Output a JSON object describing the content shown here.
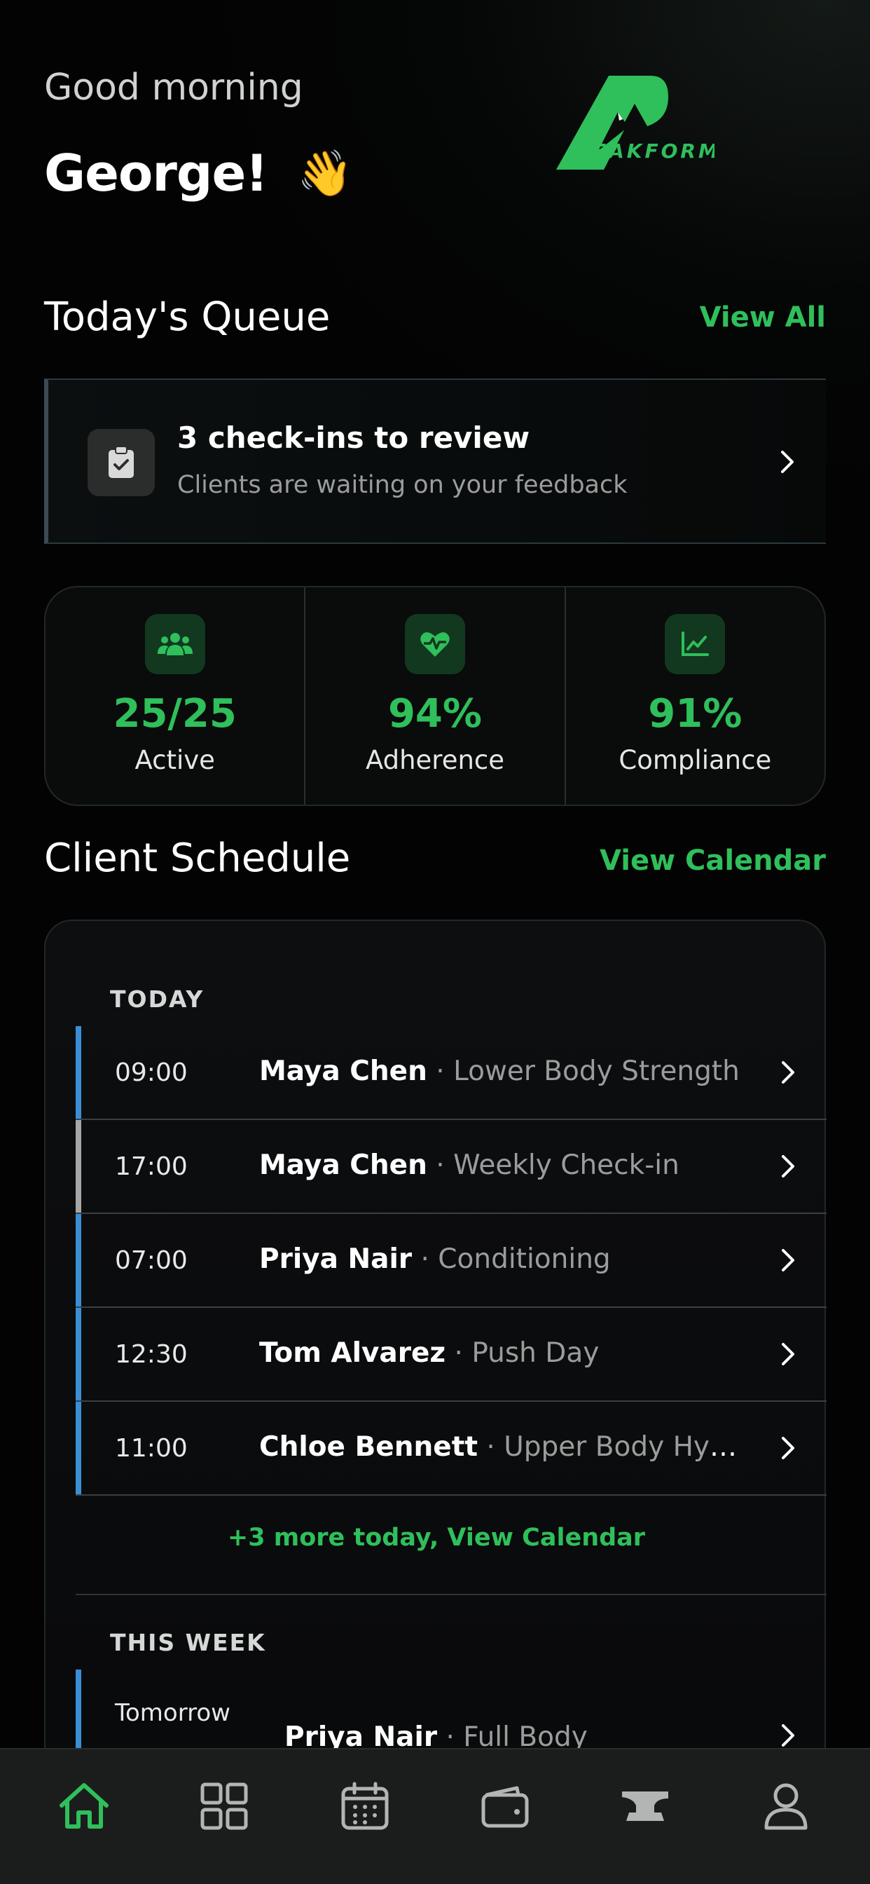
{
  "header": {
    "greeting": "Good morning",
    "name": "George!",
    "wave_emoji": "👋",
    "logo_text": "EAKFORM",
    "logo_letter": "P"
  },
  "queue": {
    "title": "Today's Queue",
    "view_all": "View All",
    "card_title": "3 check-ins to review",
    "card_subtitle": "Clients are waiting on your feedback",
    "icon": "clipboard-check-icon"
  },
  "stats": [
    {
      "value": "25/25",
      "label": "Active",
      "icon": "users-icon"
    },
    {
      "value": "94%",
      "label": "Adherence",
      "icon": "heart-pulse-icon"
    },
    {
      "value": "91%",
      "label": "Compliance",
      "icon": "chart-line-icon"
    }
  ],
  "schedule": {
    "title": "Client Schedule",
    "view_calendar": "View Calendar",
    "today_label": "TODAY",
    "week_label": "THIS WEEK",
    "today": [
      {
        "time": "09:00",
        "name": "Maya Chen",
        "sep": " · ",
        "desc": "Lower Body Strength",
        "bar": "#3b8ed4"
      },
      {
        "time": "17:00",
        "name": "Maya Chen",
        "sep": " · ",
        "desc": "Weekly Check-in",
        "bar": "#a6a6a6"
      },
      {
        "time": "07:00",
        "name": "Priya Nair",
        "sep": " · ",
        "desc": "Conditioning",
        "bar": "#3b8ed4"
      },
      {
        "time": "12:30",
        "name": "Tom Alvarez",
        "sep": " · ",
        "desc": "Push Day",
        "bar": "#3b8ed4"
      },
      {
        "time": "11:00",
        "name": "Chloe Bennett",
        "sep": " · ",
        "desc": "Upper Body Hypertrophy",
        "bar": "#3b8ed4"
      }
    ],
    "more_link": "+3 more today, View Calendar",
    "week": [
      {
        "time": "Tomorrow",
        "name": "Priya Nair",
        "sep": " · ",
        "desc": "Full Body",
        "bar": "#3b8ed4"
      }
    ]
  },
  "nav": [
    {
      "name": "home-icon",
      "active": true
    },
    {
      "name": "grid-icon",
      "active": false
    },
    {
      "name": "calendar-icon",
      "active": false
    },
    {
      "name": "wallet-icon",
      "active": false
    },
    {
      "name": "anvil-icon",
      "active": false
    },
    {
      "name": "profile-icon",
      "active": false
    }
  ],
  "colors": {
    "accent": "#2fbf5b",
    "bar_blue": "#3b8ed4",
    "bar_gray": "#a6a6a6"
  }
}
